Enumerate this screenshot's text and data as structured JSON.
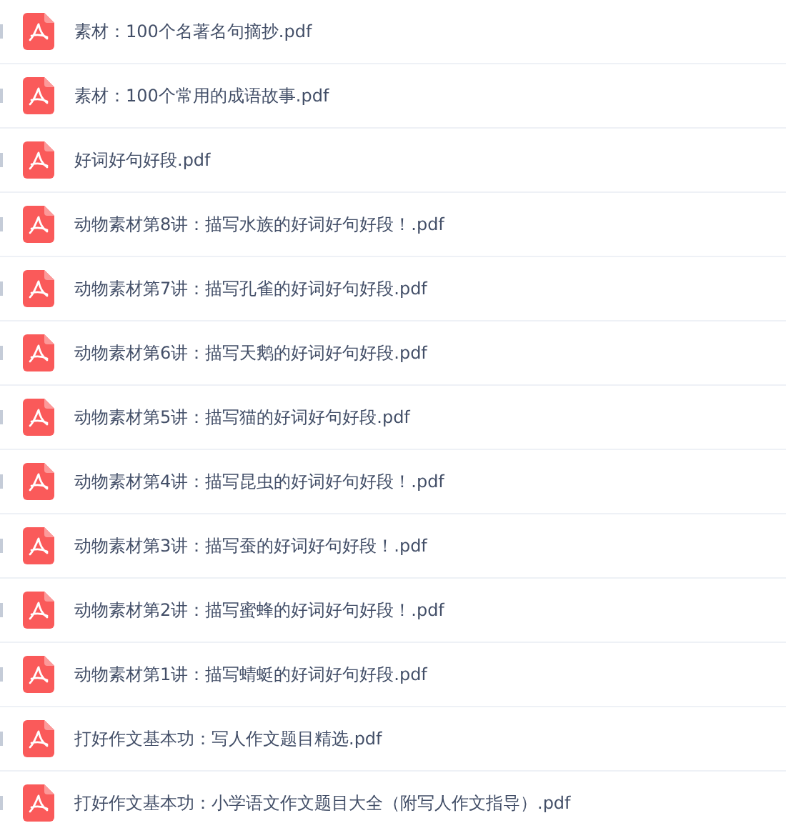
{
  "files": [
    {
      "name": "素材：100个名著名句摘抄.pdf",
      "checked": false
    },
    {
      "name": "素材：100个常用的成语故事.pdf",
      "checked": false
    },
    {
      "name": "好词好句好段.pdf",
      "checked": false
    },
    {
      "name": "动物素材第8讲：描写水族的好词好句好段！.pdf",
      "checked": false
    },
    {
      "name": "动物素材第7讲：描写孔雀的好词好句好段.pdf",
      "checked": false
    },
    {
      "name": "动物素材第6讲：描写天鹅的好词好句好段.pdf",
      "checked": false
    },
    {
      "name": "动物素材第5讲：描写猫的好词好句好段.pdf",
      "checked": false
    },
    {
      "name": "动物素材第4讲：描写昆虫的好词好句好段！.pdf",
      "checked": false
    },
    {
      "name": "动物素材第3讲：描写蚕的好词好句好段！.pdf",
      "checked": false
    },
    {
      "name": "动物素材第2讲：描写蜜蜂的好词好句好段！.pdf",
      "checked": false
    },
    {
      "name": "动物素材第1讲：描写蜻蜓的好词好句好段.pdf",
      "checked": false
    },
    {
      "name": "打好作文基本功：写人作文题目精选.pdf",
      "checked": false
    },
    {
      "name": "打好作文基本功：小学语文作文题目大全（附写人作文指导）.pdf",
      "checked": false
    }
  ]
}
